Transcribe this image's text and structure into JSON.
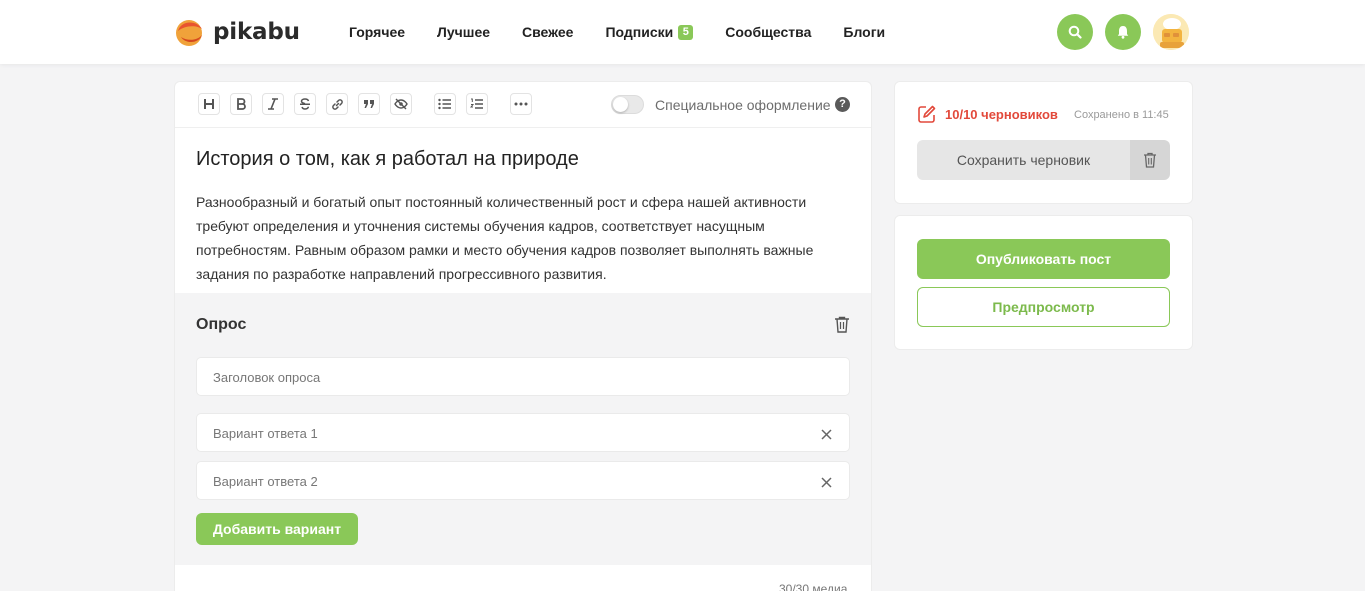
{
  "header": {
    "logo_text": "pikabu",
    "nav": [
      {
        "label": "Горячее"
      },
      {
        "label": "Лучшее"
      },
      {
        "label": "Свежее"
      },
      {
        "label": "Подписки",
        "badge": "5"
      },
      {
        "label": "Сообщества"
      },
      {
        "label": "Блоги"
      }
    ],
    "icons": [
      "search-icon",
      "bell-icon",
      "avatar"
    ]
  },
  "toolbar": {
    "tools": [
      "heading-icon",
      "bold-icon",
      "italic-icon",
      "strikethrough-icon",
      "link-icon",
      "quote-icon",
      "spoiler-icon",
      "bulleted-list-icon",
      "numbered-list-icon",
      "more-icon"
    ],
    "special_label": "Специальное оформление",
    "special_enabled": false,
    "help": "?"
  },
  "post": {
    "title": "История о том, как я работал на природе",
    "body": "Разнообразный и богатый опыт постоянный количественный рост и сфера нашей активности требуют определения и уточнения системы обучения кадров, соответствует насущным потребностям. Равным образом рамки и место обучения кадров позволяет выполнять важные задания по разработке направлений прогрессивного развития."
  },
  "poll": {
    "title": "Опрос",
    "title_placeholder": "Заголовок опроса",
    "options": [
      {
        "placeholder": "Вариант ответа 1"
      },
      {
        "placeholder": "Вариант ответа 2"
      }
    ],
    "add_label": "Добавить вариант"
  },
  "media": {
    "count_label": "30/30 медиа"
  },
  "drafts": {
    "count_label": "10/10 черновиков",
    "saved_label": "Сохранено в 11:45",
    "save_label": "Сохранить черновик"
  },
  "actions": {
    "publish_label": "Опубликовать пост",
    "preview_label": "Предпросмотр"
  },
  "colors": {
    "accent": "#8ac858",
    "danger": "#e2493b",
    "background": "#f4f4f5"
  }
}
